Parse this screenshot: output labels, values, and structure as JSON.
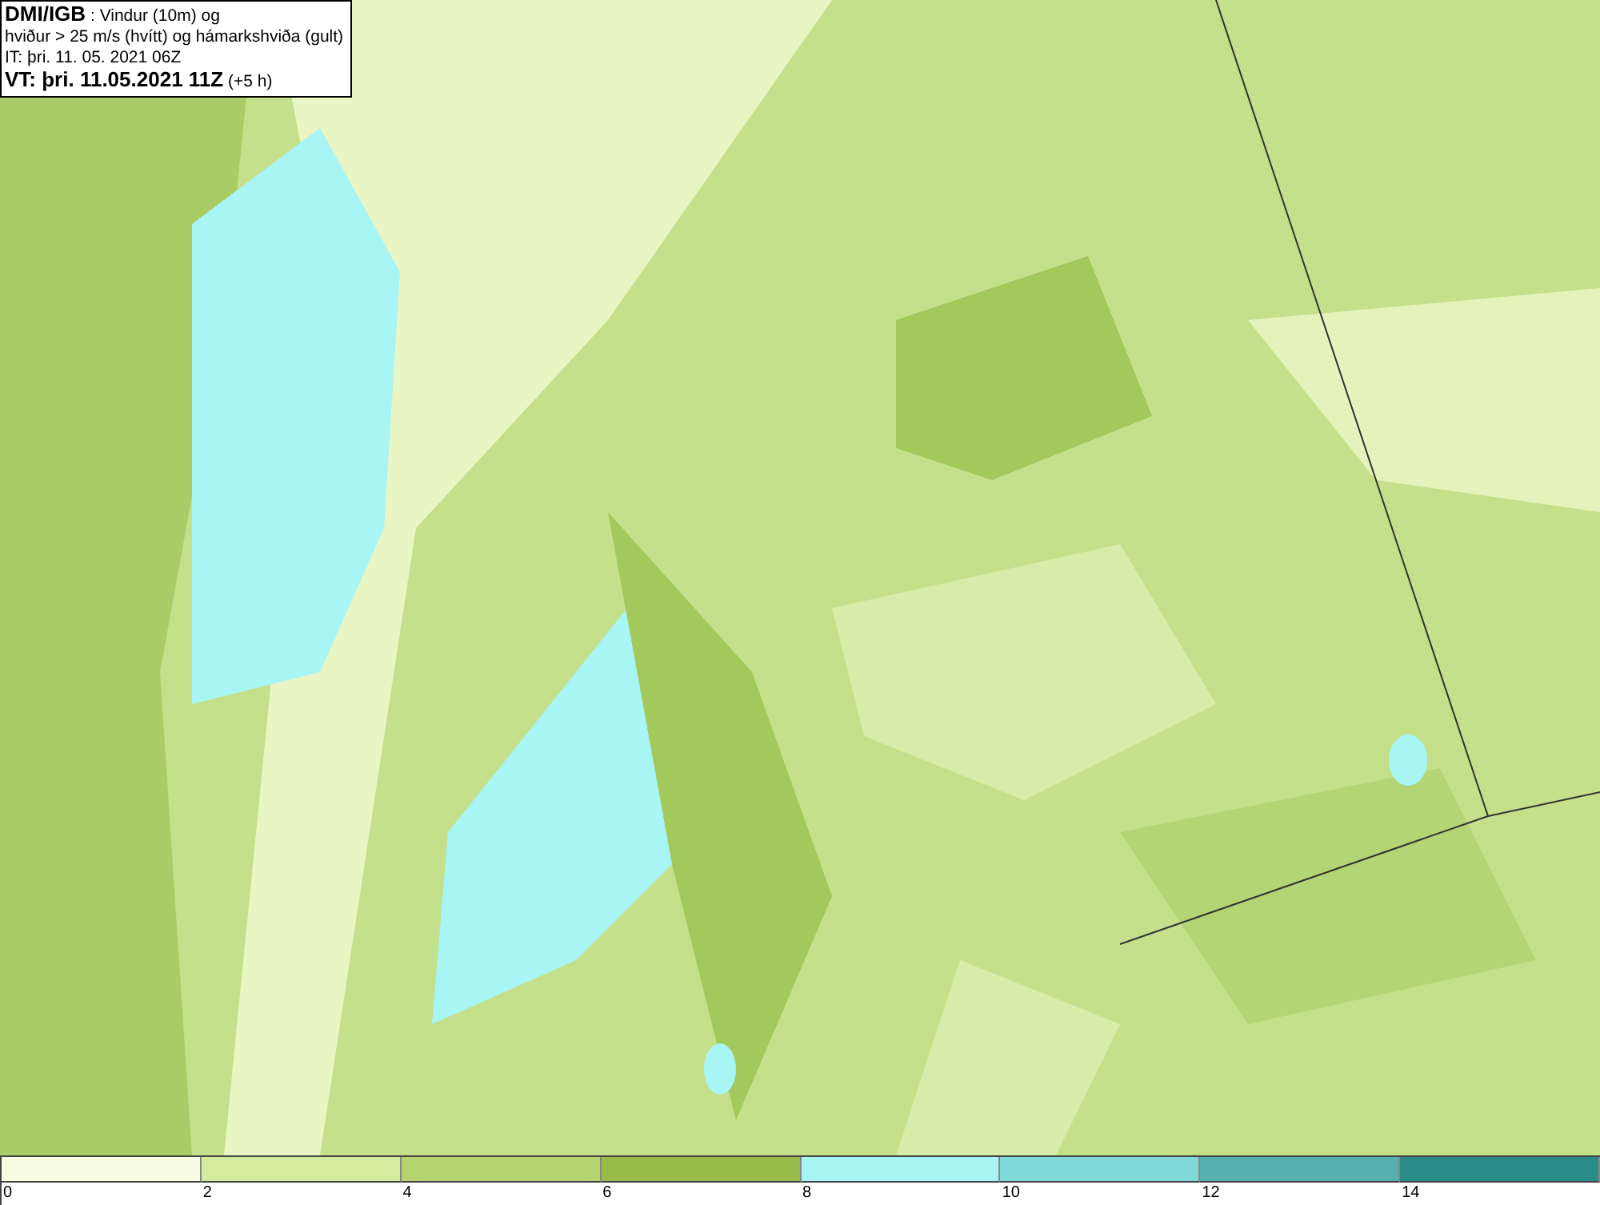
{
  "header": {
    "lines": [
      "**DMI/IGB** : Vindur (10m) og",
      "hviður > 25 m/s (hvítt) og hámarkshviða (gult)",
      "IT: þri. 11. 05. 2021 06Z",
      "**VT: þri. 11.05.2021 11Z** (+5 h)"
    ]
  },
  "legend": [
    {
      "label": "0",
      "color": "#f7fbe0"
    },
    {
      "label": "2",
      "color": "#d5eb9e"
    },
    {
      "label": "4",
      "color": "#b5d36e"
    },
    {
      "label": "6",
      "color": "#98ba48"
    },
    {
      "label": "8",
      "color": "#a8f5f5"
    },
    {
      "label": "10",
      "color": "#80d8d8"
    },
    {
      "label": "12",
      "color": "#55b0b0"
    },
    {
      "label": "14",
      "color": "#2a8c88"
    }
  ]
}
